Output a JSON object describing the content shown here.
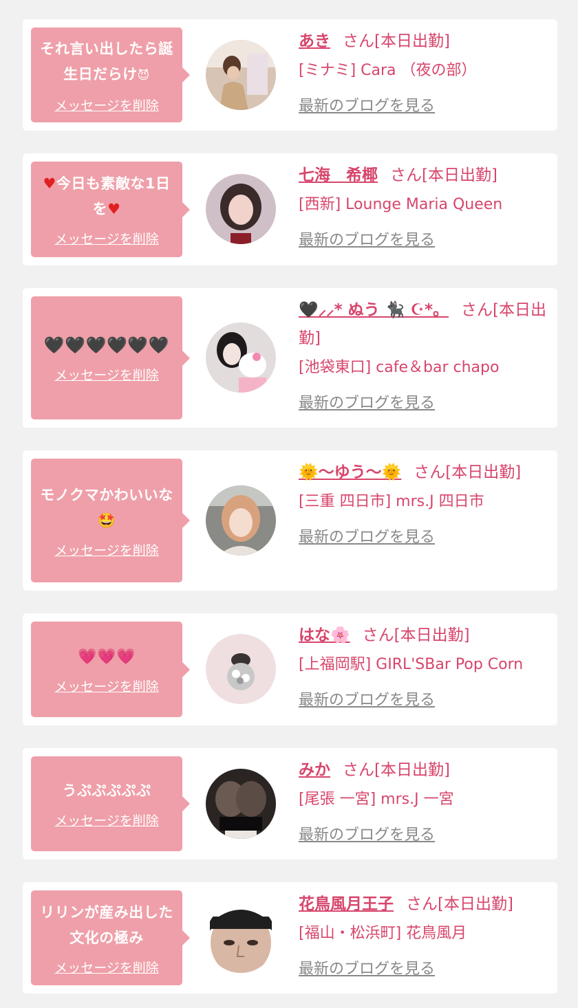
{
  "colors": {
    "page_bg": "#f1f1f1",
    "card_bg": "#ffffff",
    "bubble_bg": "#ef9fa9",
    "accent_text": "#d7456b",
    "muted_link": "#888888"
  },
  "common": {
    "delete_label": "メッセージを削除",
    "blog_label": "最新のブログを見る"
  },
  "messages": [
    {
      "message_text": "それ言い出したら誕生日だらけ",
      "message_emoji": "😈",
      "name": "あき",
      "honorific_status": "さん[本日出勤]",
      "area": "[ミナミ]",
      "shop": "Cara （夜の部）"
    },
    {
      "message_prefix": "♥",
      "message_text": "今日も素敵な1日を",
      "message_suffix": "♥",
      "name": "七海　希椰",
      "honorific_status": "さん[本日出勤]",
      "area": "[西新]",
      "shop": "Lounge Maria Queen"
    },
    {
      "message_text": "🖤🖤🖤🖤🖤🖤",
      "name": "🖤‪‪⸝⸝* ぬう 🐈‍⬛ ☪︎*。",
      "honorific_status": "さん[本日出勤]",
      "area": "[池袋東口]",
      "shop": "cafe＆bar chapo"
    },
    {
      "message_text": "モノクマかわいいな",
      "message_emoji": "🤩",
      "name": "🌞〜ゆう〜🌞",
      "honorific_status": "さん[本日出勤]",
      "area": "[三重 四日市]",
      "shop": "mrs.J 四日市"
    },
    {
      "message_text": "💗💗💗",
      "name": "はな",
      "name_emoji": "🌸",
      "honorific_status": "さん[本日出勤]",
      "area": "[上福岡駅]",
      "shop": "GIRL'SBar Pop Corn"
    },
    {
      "message_text": "うぷぷぷぷぷ",
      "name": "みか",
      "honorific_status": "さん[本日出勤]",
      "area": "[尾張 一宮]",
      "shop": "mrs.J 一宮"
    },
    {
      "message_text": "リリンが産み出した文化の極み",
      "name": "花鳥風月王子",
      "honorific_status": "さん[本日出勤]",
      "area": "[福山・松浜町]",
      "shop": "花鳥風月"
    }
  ]
}
